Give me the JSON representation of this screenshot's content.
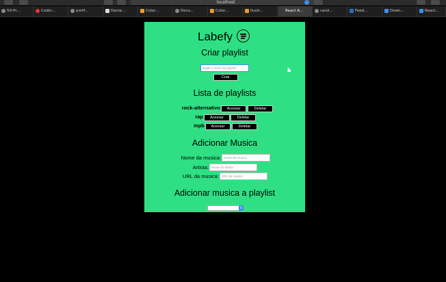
{
  "browser": {
    "url": "localhost",
    "tabs": [
      {
        "label": "50-Pr..."
      },
      {
        "label": "Codin..."
      },
      {
        "label": "portf..."
      },
      {
        "label": "Danie..."
      },
      {
        "label": "Color..."
      },
      {
        "label": "Docu..."
      },
      {
        "label": "Color..."
      },
      {
        "label": "Ilustr..."
      },
      {
        "label": "React A..."
      },
      {
        "label": "carol..."
      },
      {
        "label": "Feed..."
      },
      {
        "label": "Down..."
      },
      {
        "label": "React..."
      }
    ],
    "active_tab_index": 8
  },
  "app": {
    "title": "Labefy",
    "create_heading": "Criar playlist",
    "create_placeholder": "Digite o nome da playlist",
    "create_button": "Criar",
    "list_heading": "Lista de playlists",
    "playlists": [
      {
        "name": "rock-alternativo",
        "access": "Acessar",
        "delete": "Deletar"
      },
      {
        "name": "rap",
        "access": "Acessar",
        "delete": "Deletar"
      },
      {
        "name": "mpb",
        "access": "Acessar",
        "delete": "Deletar"
      }
    ],
    "add_music_heading": "Adicionar Musica",
    "fields": [
      {
        "label": "Nome da musica:",
        "placeholder": "Nome da musica"
      },
      {
        "label": "Artista:",
        "placeholder": "Nome do artista"
      },
      {
        "label": "URL da musica:",
        "placeholder": "URL da musica"
      }
    ],
    "add_to_playlist_heading": "Adicionar musica a playlist",
    "select_value": ""
  },
  "colors": {
    "page_bg": "#2ee083",
    "accent": "#3a8ff0"
  }
}
